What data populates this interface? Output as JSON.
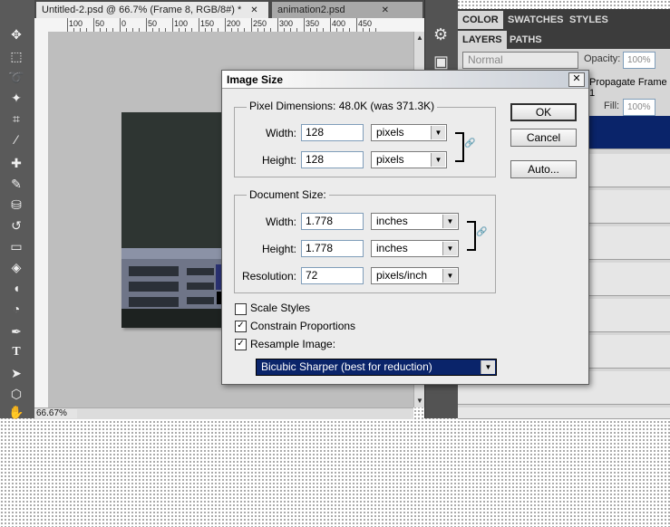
{
  "tabs": {
    "doc1": "Untitled-2.psd @ 66.7% (Frame 8, RGB/8#) *",
    "doc2": "animation2.psd",
    "close_symbol": "✕"
  },
  "ruler": {
    "h_numbers": [
      "100",
      "50",
      "0",
      "50",
      "100",
      "150",
      "200",
      "250",
      "300",
      "350",
      "400",
      "450"
    ]
  },
  "status": {
    "zoom": "66.67%"
  },
  "panels": {
    "tab_color": "COLOR",
    "tab_swatches": "SWATCHES",
    "tab_styles": "STYLES",
    "tab_layers": "LAYERS",
    "tab_paths": "PATHS",
    "blend_mode": "Normal",
    "opacity_label": "Opacity:",
    "opacity_value": "100%",
    "propagate_label": "Propagate Frame 1",
    "fill_label": "Fill:",
    "fill_value": "100%",
    "selected_layer_color": "#0a246a"
  },
  "dialog": {
    "title": "Image Size",
    "close": "✕",
    "pixel_dimensions_label": "Pixel Dimensions:",
    "pixel_dimensions_value": "48.0K (was 371.3K)",
    "px_width_label": "Width:",
    "px_width_value": "128",
    "px_width_unit": "pixels",
    "px_height_label": "Height:",
    "px_height_value": "128",
    "px_height_unit": "pixels",
    "document_size_label": "Document Size:",
    "doc_width_label": "Width:",
    "doc_width_value": "1.778",
    "doc_width_unit": "inches",
    "doc_height_label": "Height:",
    "doc_height_value": "1.778",
    "doc_height_unit": "inches",
    "resolution_label": "Resolution:",
    "resolution_value": "72",
    "resolution_unit": "pixels/inch",
    "scale_styles_label": "Scale Styles",
    "scale_styles_checked": false,
    "constrain_label": "Constrain Proportions",
    "constrain_checked": true,
    "resample_label": "Resample Image:",
    "resample_checked": true,
    "resample_method": "Bicubic Sharper (best for reduction)",
    "ok_label": "OK",
    "cancel_label": "Cancel",
    "auto_label": "Auto...",
    "check_mark": "✓",
    "dropdown_arrow": "▼",
    "link_icon": "🔗"
  },
  "icons": {
    "move": "✥",
    "marquee": "⬚",
    "lasso": "➰",
    "magic_wand": "✦",
    "crop": "⌗",
    "eyedropper": "⁄",
    "healing": "✚",
    "brush": "✎",
    "stamp": "⛁",
    "history_brush": "↺",
    "eraser": "▭",
    "paint_bucket": "◈",
    "blur": "◖",
    "dodge": "◔",
    "pen": "✒",
    "type": "T",
    "path_select": "➤",
    "shape": "⬡",
    "hand": "✋",
    "panel_wheel": "⚙",
    "panel_image": "▣"
  }
}
